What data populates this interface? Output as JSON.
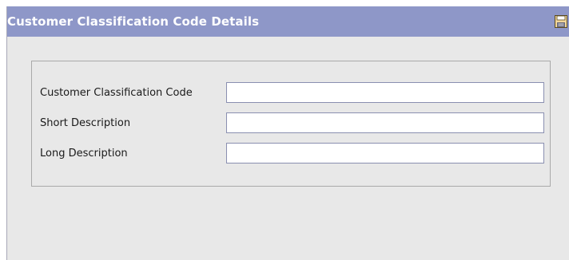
{
  "window": {
    "title": "Customer Classification Code Details",
    "save_icon": "save-icon"
  },
  "form": {
    "fields": [
      {
        "label": "Customer Classification Code",
        "value": ""
      },
      {
        "label": "Short Description",
        "value": ""
      },
      {
        "label": "Long Description",
        "value": ""
      }
    ]
  },
  "colors": {
    "titlebar": "#8e97c8",
    "background": "#e8e8e8",
    "input_border": "#8a8fb0"
  }
}
